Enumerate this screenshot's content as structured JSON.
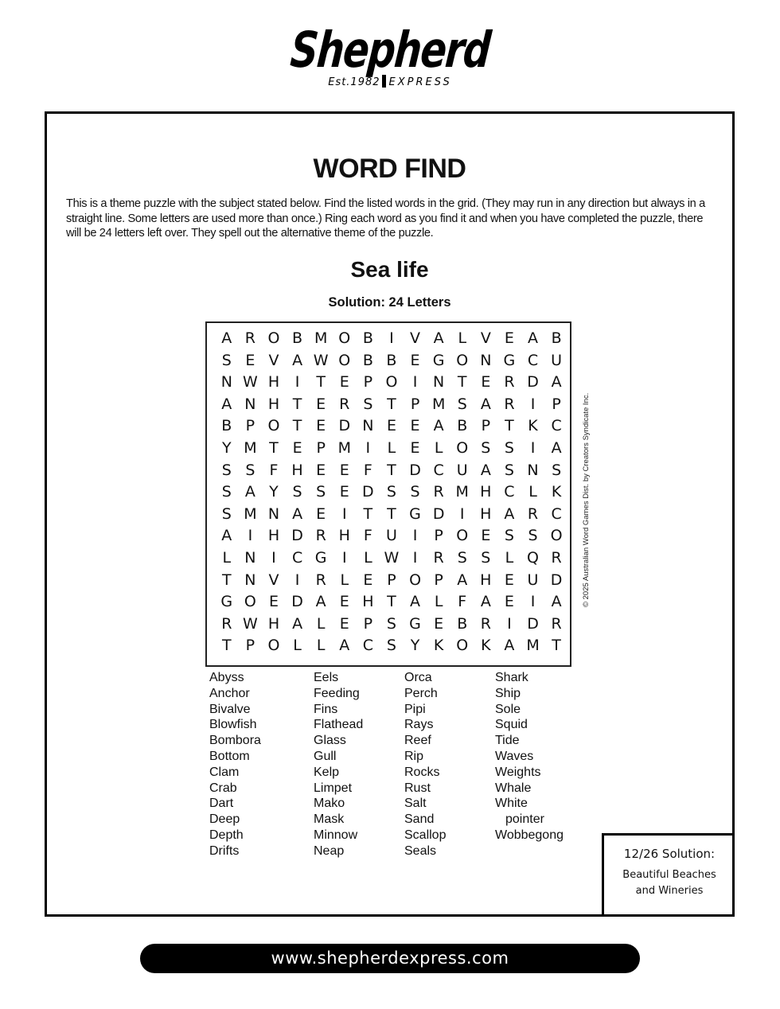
{
  "masthead": {
    "name": "Shepherd",
    "established": "Est.1982",
    "tagline": "EXPRESS"
  },
  "puzzle": {
    "title": "WORD FIND",
    "intro": "This is a theme puzzle with the subject stated below. Find the listed words in the grid. (They may run in any direction but always in a straight line. Some letters are used more than once.) Ring each word as you find it and when you have completed the puzzle, there will be 24 letters left over. They spell out the alternative theme of the puzzle.",
    "subject": "Sea life",
    "solution_count": "Solution: 24 Letters",
    "grid": [
      [
        "A",
        "R",
        "O",
        "B",
        "M",
        "O",
        "B",
        "I",
        "V",
        "A",
        "L",
        "V",
        "E",
        "A",
        "B"
      ],
      [
        "S",
        "E",
        "V",
        "A",
        "W",
        "O",
        "B",
        "B",
        "E",
        "G",
        "O",
        "N",
        "G",
        "C",
        "U"
      ],
      [
        "N",
        "W",
        "H",
        "I",
        "T",
        "E",
        "P",
        "O",
        "I",
        "N",
        "T",
        "E",
        "R",
        "D",
        "A"
      ],
      [
        "A",
        "N",
        "H",
        "T",
        "E",
        "R",
        "S",
        "T",
        "P",
        "M",
        "S",
        "A",
        "R",
        "I",
        "P"
      ],
      [
        "B",
        "P",
        "O",
        "T",
        "E",
        "D",
        "N",
        "E",
        "E",
        "A",
        "B",
        "P",
        "T",
        "K",
        "C"
      ],
      [
        "Y",
        "M",
        "T",
        "E",
        "P",
        "M",
        "I",
        "L",
        "E",
        "L",
        "O",
        "S",
        "S",
        "I",
        "A"
      ],
      [
        "S",
        "S",
        "F",
        "H",
        "E",
        "E",
        "F",
        "T",
        "D",
        "C",
        "U",
        "A",
        "S",
        "N",
        "S"
      ],
      [
        "S",
        "A",
        "Y",
        "S",
        "S",
        "E",
        "D",
        "S",
        "S",
        "R",
        "M",
        "H",
        "C",
        "L",
        "K"
      ],
      [
        "S",
        "M",
        "N",
        "A",
        "E",
        "I",
        "T",
        "T",
        "G",
        "D",
        "I",
        "H",
        "A",
        "R",
        "C"
      ],
      [
        "A",
        "I",
        "H",
        "D",
        "R",
        "H",
        "F",
        "U",
        "I",
        "P",
        "O",
        "E",
        "S",
        "S",
        "O"
      ],
      [
        "L",
        "N",
        "I",
        "C",
        "G",
        "I",
        "L",
        "W",
        "I",
        "R",
        "S",
        "S",
        "L",
        "Q",
        "R"
      ],
      [
        "T",
        "N",
        "V",
        "I",
        "R",
        "L",
        "E",
        "P",
        "O",
        "P",
        "A",
        "H",
        "E",
        "U",
        "D"
      ],
      [
        "G",
        "O",
        "E",
        "D",
        "A",
        "E",
        "H",
        "T",
        "A",
        "L",
        "F",
        "A",
        "E",
        "I",
        "A"
      ],
      [
        "R",
        "W",
        "H",
        "A",
        "L",
        "E",
        "P",
        "S",
        "G",
        "E",
        "B",
        "R",
        "I",
        "D",
        "R"
      ],
      [
        "T",
        "P",
        "O",
        "L",
        "L",
        "A",
        "C",
        "S",
        "Y",
        "K",
        "O",
        "K",
        "A",
        "M",
        "T"
      ]
    ],
    "copyright": "© 2025 Australian Word Games Dist. by Creators Syndicate Inc.",
    "word_columns": [
      [
        "Abyss",
        "Anchor",
        "Bivalve",
        "Blowfish",
        "Bombora",
        "Bottom",
        "Clam",
        "Crab",
        "Dart",
        "Deep",
        "Depth",
        "Drifts"
      ],
      [
        "Eels",
        "Feeding",
        "Fins",
        "Flathead",
        "Glass",
        "Gull",
        "Kelp",
        "Limpet",
        "Mako",
        "Mask",
        "Minnow",
        "Neap"
      ],
      [
        "Orca",
        "Perch",
        "Pipi",
        "Rays",
        "Reef",
        "Rip",
        "Rocks",
        "Rust",
        "Salt",
        "Sand",
        "Scallop",
        "Seals"
      ],
      [
        "Shark",
        "Ship",
        "Sole",
        "Squid",
        "Tide",
        "Waves",
        "Weights",
        "Whale",
        "White",
        "pointer",
        "Wobbegong"
      ]
    ],
    "previous_solution": {
      "title": "12/26 Solution:",
      "answer_line1": "Beautiful Beaches",
      "answer_line2": "and Wineries"
    }
  },
  "footer": {
    "url": "www.shepherdexpress.com"
  }
}
